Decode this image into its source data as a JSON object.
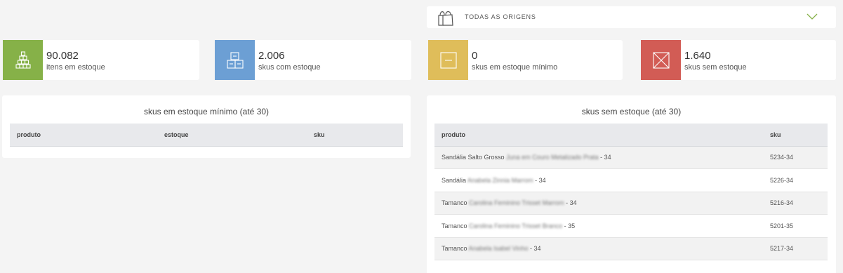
{
  "origin_selector": {
    "label": "TODAS AS ORIGENS",
    "icon": "shopping-bag-icon",
    "chevron": "chevron-down-icon",
    "accent": "#86b148"
  },
  "stats": [
    {
      "value": "90.082",
      "label": "itens em estoque",
      "icon": "stacked-boxes-icon",
      "color": "#86b148"
    },
    {
      "value": "2.006",
      "label": "skus com estoque",
      "icon": "boxes-icon",
      "color": "#6c9fd4"
    },
    {
      "value": "0",
      "label": "skus em estoque mínimo",
      "icon": "minimum-box-icon",
      "color": "#dfbd5a"
    },
    {
      "value": "1.640",
      "label": "skus sem estoque",
      "icon": "empty-box-icon",
      "color": "#d25c55"
    }
  ],
  "min_stock_panel": {
    "title": "skus em estoque mínimo (até 30)",
    "columns": [
      "produto",
      "estoque",
      "sku"
    ]
  },
  "no_stock_panel": {
    "title": "skus sem estoque (até 30)",
    "columns": [
      "produto",
      "sku"
    ],
    "rows": [
      {
        "product_prefix": "Sandália Salto Grosso",
        "product_blurred": "Juna em Couro Metalizado Prata",
        "product_suffix": "- 34",
        "sku": "5234-34"
      },
      {
        "product_prefix": "Sandália",
        "product_blurred": "Anabela Zinnia Marrom",
        "product_suffix": "- 34",
        "sku": "5226-34"
      },
      {
        "product_prefix": "Tamanco",
        "product_blurred": "Carolina Feminino Trisset Marrom",
        "product_suffix": "- 34",
        "sku": "5216-34"
      },
      {
        "product_prefix": "Tamanco",
        "product_blurred": "Carolina Feminino Trisset Branco",
        "product_suffix": "- 35",
        "sku": "5201-35"
      },
      {
        "product_prefix": "Tamanco",
        "product_blurred": "Anabela Isabel Vinho",
        "product_suffix": "- 34",
        "sku": "5217-34"
      }
    ]
  }
}
